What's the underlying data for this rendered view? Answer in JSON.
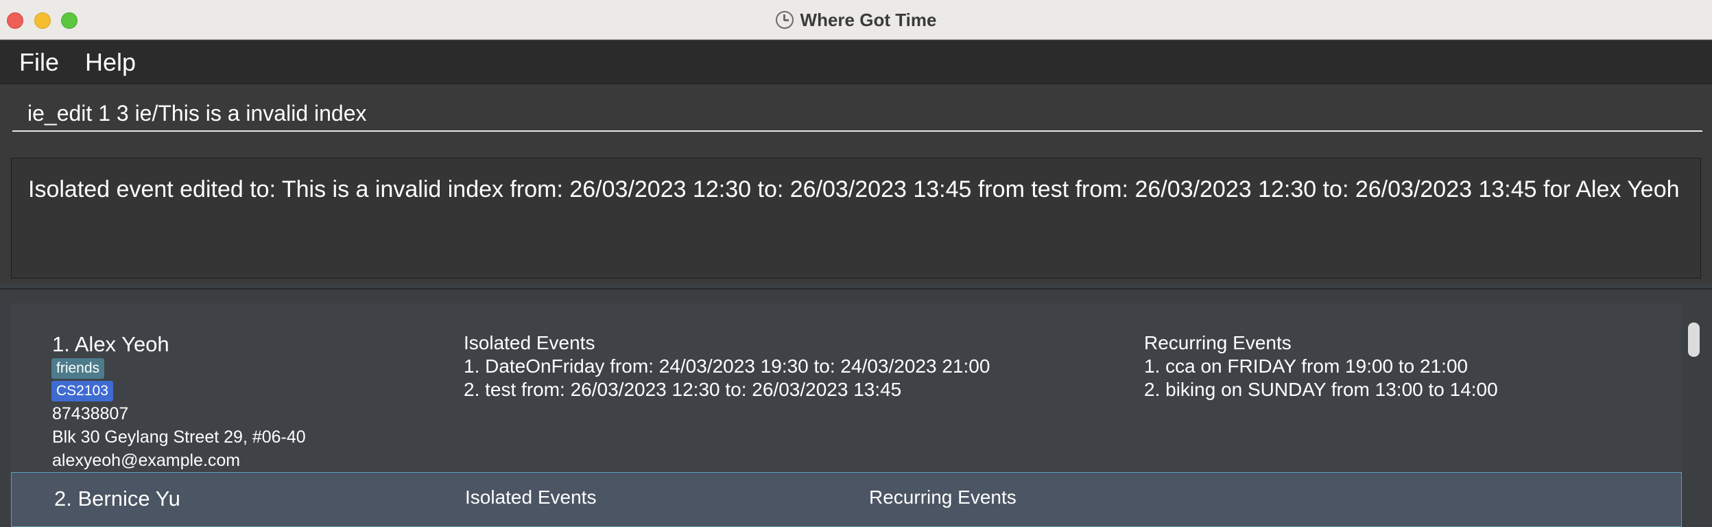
{
  "window": {
    "title": "Where Got Time",
    "title_icon": "clock-icon"
  },
  "menu": {
    "items": [
      "File",
      "Help"
    ]
  },
  "command": {
    "value": "ie_edit 1 3 ie/This is a invalid index"
  },
  "result": {
    "text": "Isolated event edited to: This is a invalid index from: 26/03/2023 12:30 to: 26/03/2023 13:45 from test from: 26/03/2023 12:30 to: 26/03/2023 13:45 for Alex Yeoh"
  },
  "persons": [
    {
      "name": "1. Alex Yeoh",
      "tags": [
        "friends",
        "CS2103"
      ],
      "phone": "87438807",
      "address": "Blk 30 Geylang Street 29, #06-40",
      "email": "alexyeoh@example.com",
      "isolated_title": "Isolated Events",
      "isolated_events": [
        "1. DateOnFriday from: 24/03/2023 19:30 to: 24/03/2023 21:00",
        "2. test from: 26/03/2023 12:30 to: 26/03/2023 13:45"
      ],
      "recurring_title": "Recurring Events",
      "recurring_events": [
        "1. cca on FRIDAY from 19:00 to 21:00",
        "2. biking on SUNDAY from 13:00 to 14:00"
      ]
    },
    {
      "name": "2. Bernice Yu",
      "isolated_title": "Isolated Events",
      "recurring_title": "Recurring Events"
    }
  ],
  "colors": {
    "tag_friends": "#4d7b8c",
    "tag_cs2103": "#3e6cd2",
    "selected_border": "#5aa0c4"
  }
}
